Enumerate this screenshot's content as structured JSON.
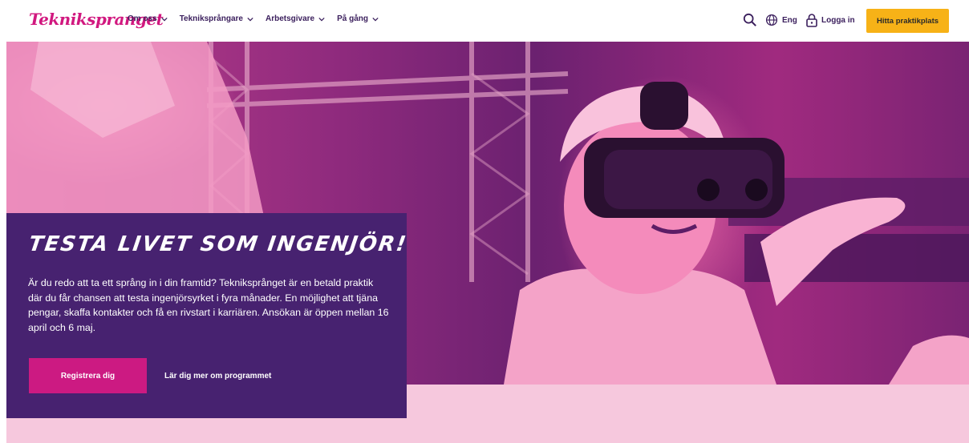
{
  "header": {
    "logo": "Teknikspranget",
    "nav": [
      {
        "label": "Om oss"
      },
      {
        "label": "Tekniksprångare"
      },
      {
        "label": "Arbetsgivare"
      },
      {
        "label": "På gång"
      }
    ],
    "lang_label": "Eng",
    "login_label": "Logga in",
    "cta_label": "Hitta praktikplats",
    "icons": [
      "search-icon",
      "globe-icon",
      "lock-icon",
      "chevron-down-icon"
    ]
  },
  "hero": {
    "title": "TESTA LIVET SOM INGENJÖR!",
    "body": "Är du redo att ta ett språng in i din framtid? Tekniksprånget är en betald praktik där du får chansen att testa ingenjörsyrket i fyra månader. En möjlighet att tjäna pengar, skaffa kontakter och få en rivstart i karriären. Ansökan är öppen mellan 16 april och 6 maj.",
    "register_label": "Registrera dig",
    "learn_label": "Lär dig mer om programmet"
  },
  "colors": {
    "brand_pink": "#d1187f",
    "brand_purple": "#472270",
    "cta_yellow": "#f7b217",
    "soft_pink": "#f6c8dd"
  }
}
